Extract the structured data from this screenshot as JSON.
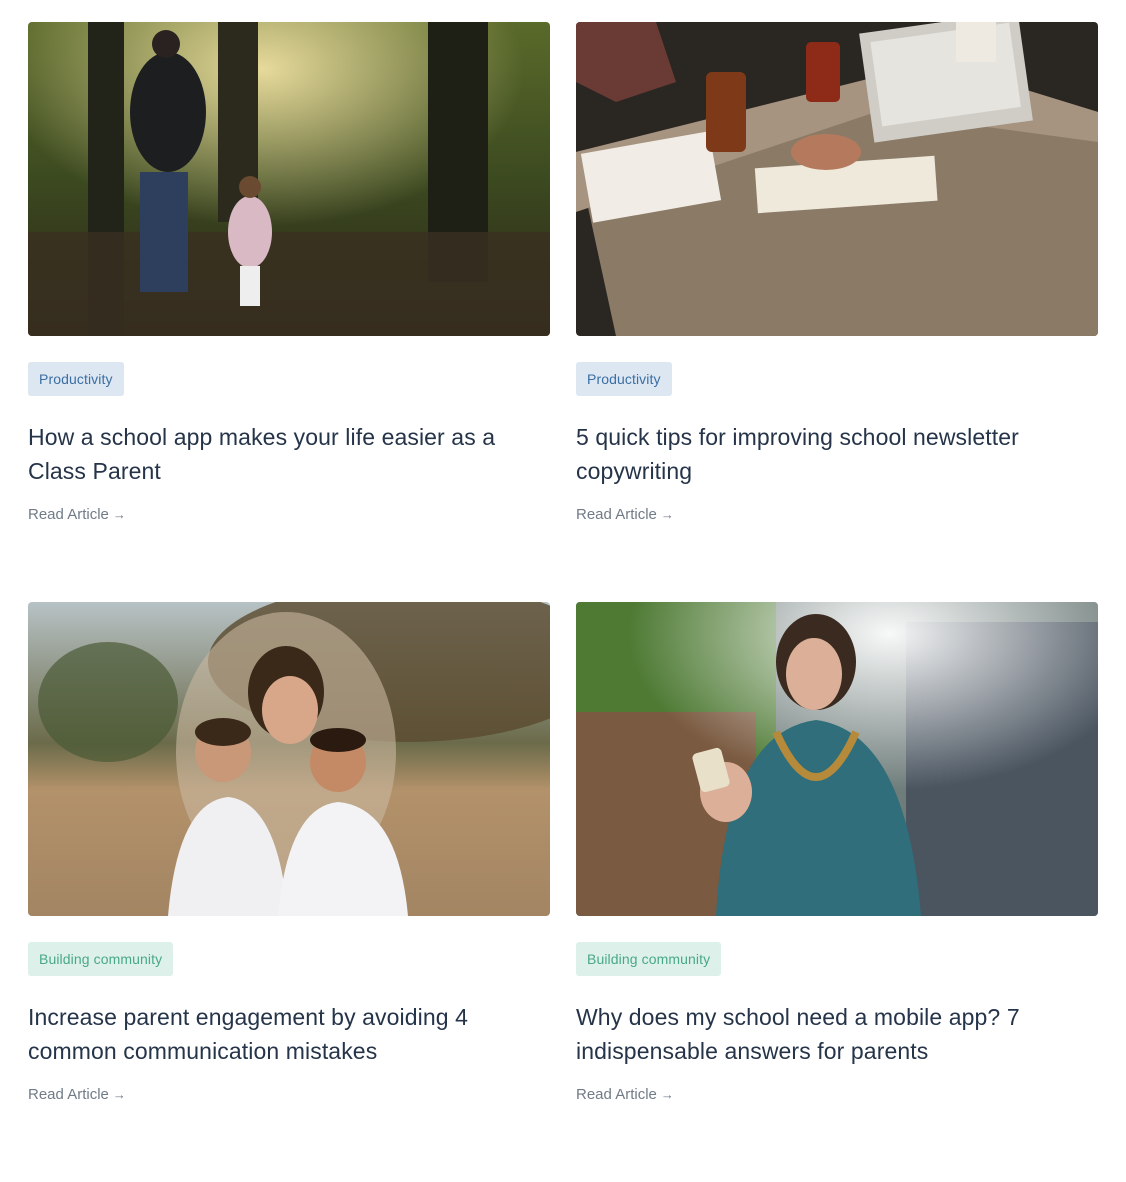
{
  "articles": [
    {
      "image": "father-and-child-walking-in-forest",
      "tag": "Productivity",
      "tag_color": "#3b6ea3",
      "title": "How a school app makes your life easier as a Class Parent",
      "link": "Read Article"
    },
    {
      "image": "people-working-at-table-with-laptops",
      "tag": "Productivity",
      "tag_color": "#3b6ea3",
      "title": "5 quick tips for improving school newsletter copywriting",
      "link": "Read Article"
    },
    {
      "image": "mother-with-two-smiling-boys-outdoors",
      "tag": "Building community",
      "tag_color": "#4aa886",
      "title": "Increase parent engagement by avoiding 4 common communication mistakes",
      "link": "Read Article"
    },
    {
      "image": "smiling-woman-holding-phone",
      "tag": "Building community",
      "tag_color": "#4aa886",
      "title": "Why does my school need a mobile app? 7 indispensable answers for parents",
      "link": "Read Article"
    }
  ],
  "arrow_icon": "arrow-right-icon"
}
